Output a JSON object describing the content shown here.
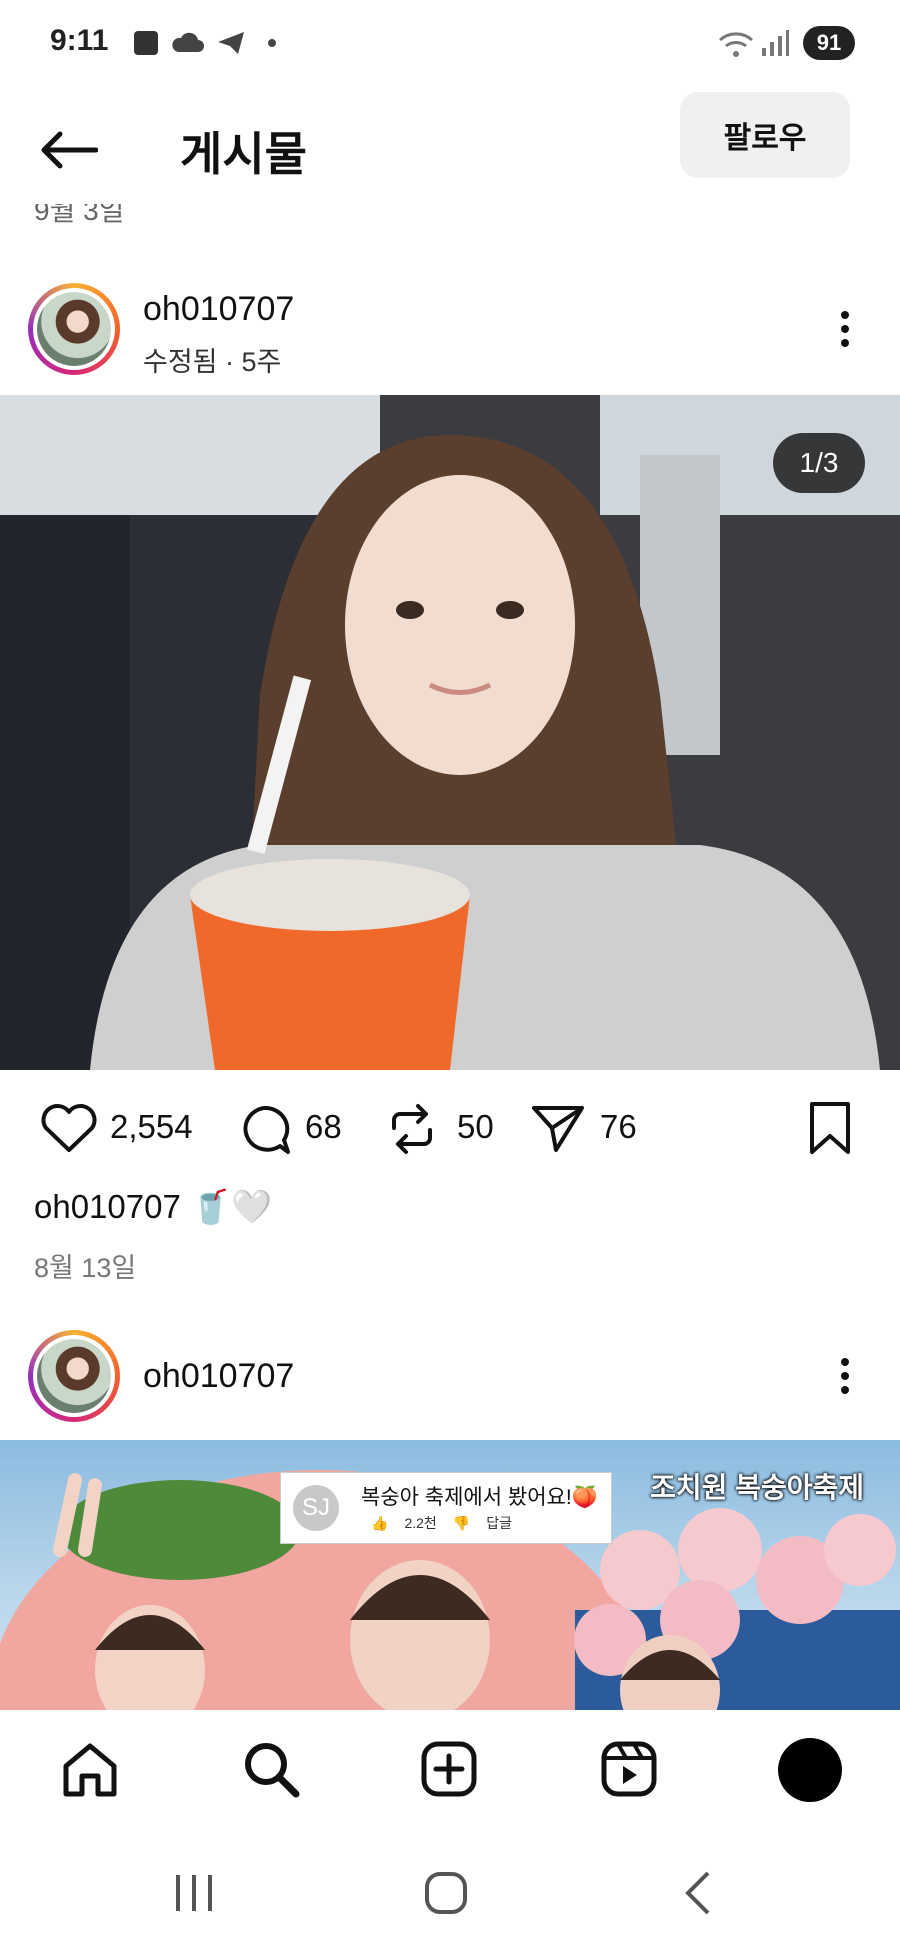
{
  "status_bar": {
    "time": "9:11",
    "battery": "91"
  },
  "header": {
    "title": "게시물",
    "follow_label": "팔로우",
    "cut_date": "9월 3일"
  },
  "post1": {
    "username": "oh010707",
    "subline": "수정됨 · 5주",
    "image_counter": "1/3",
    "likes": "2,554",
    "comments": "68",
    "reposts": "50",
    "shares": "76",
    "caption_user": "oh010707",
    "caption_emoji": "🥤🤍",
    "date": "8월 13일"
  },
  "post2": {
    "username": "oh010707",
    "comment_initials": "SJ",
    "comment_text": "복숭아 축제에서 봤어요!🍑",
    "comment_likes": "2.2천",
    "comment_reply": "답글",
    "festival_title": "조치원 복숭아축제"
  },
  "colors": {
    "accent_follow_bg": "#eef0f2",
    "story_ring": "#d62976"
  },
  "icons": [
    "back-arrow-icon",
    "kebab-icon",
    "heart-icon",
    "comment-icon",
    "repost-icon",
    "send-icon",
    "bookmark-icon",
    "home-icon",
    "search-icon",
    "create-icon",
    "reels-icon",
    "profile-avatar"
  ]
}
